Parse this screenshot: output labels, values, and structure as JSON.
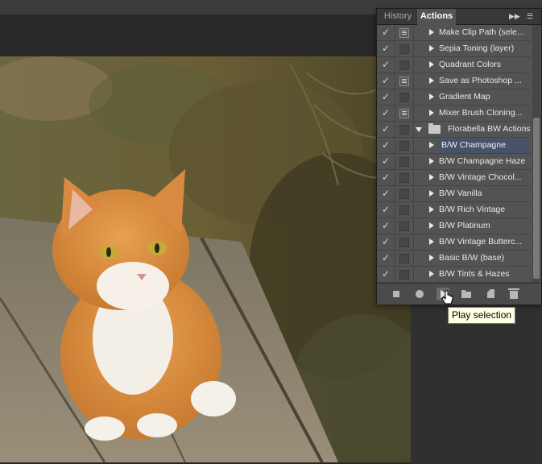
{
  "panel": {
    "tabs": [
      {
        "label": "History",
        "active": false
      },
      {
        "label": "Actions",
        "active": true
      }
    ],
    "collapse_glyph": "▶▶",
    "menu_glyph": "☰"
  },
  "actions": [
    {
      "label": "Make Clip Path (sele...",
      "checked": true,
      "dialog": true,
      "type": "action"
    },
    {
      "label": "Sepia Toning (layer)",
      "checked": true,
      "dialog": false,
      "type": "action"
    },
    {
      "label": "Quadrant Colors",
      "checked": true,
      "dialog": false,
      "type": "action"
    },
    {
      "label": "Save as Photoshop ...",
      "checked": true,
      "dialog": true,
      "type": "action"
    },
    {
      "label": "Gradient Map",
      "checked": true,
      "dialog": false,
      "type": "action"
    },
    {
      "label": "Mixer Brush Cloning...",
      "checked": true,
      "dialog": true,
      "type": "action"
    },
    {
      "label": "Florabella BW Actions",
      "checked": true,
      "dialog": false,
      "type": "set"
    },
    {
      "label": "B/W Champagne",
      "checked": true,
      "dialog": false,
      "type": "action",
      "selected": true
    },
    {
      "label": "B/W Champagne Haze",
      "checked": true,
      "dialog": false,
      "type": "action"
    },
    {
      "label": "B/W Vintage Chocol...",
      "checked": true,
      "dialog": false,
      "type": "action"
    },
    {
      "label": "B/W Vanilla",
      "checked": true,
      "dialog": false,
      "type": "action"
    },
    {
      "label": "B/W Rich Vintage",
      "checked": true,
      "dialog": false,
      "type": "action"
    },
    {
      "label": "B/W Platinum",
      "checked": true,
      "dialog": false,
      "type": "action"
    },
    {
      "label": "B/W Vintage Butterc...",
      "checked": true,
      "dialog": false,
      "type": "action"
    },
    {
      "label": "Basic B/W (base)",
      "checked": true,
      "dialog": false,
      "type": "action"
    },
    {
      "label": "B/W Tints & Hazes",
      "checked": true,
      "dialog": false,
      "type": "action"
    }
  ],
  "toolbar": {
    "buttons": [
      "stop-playing-icon",
      "begin-recording-icon",
      "play-selection-icon",
      "create-new-set-icon",
      "create-new-action-icon",
      "delete-icon"
    ]
  },
  "tooltip": {
    "text": "Play selection"
  },
  "check_glyph": "✓",
  "colors": {
    "selection": "#46536b",
    "tooltip_bg": "#ffffe1"
  }
}
